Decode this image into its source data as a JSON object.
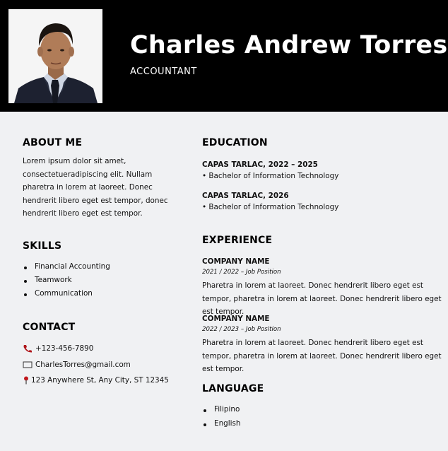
{
  "header": {
    "name": "Charles Andrew Torres",
    "role": "ACCOUNTANT"
  },
  "about": {
    "title": "ABOUT ME",
    "text": "Lorem ipsum dolor sit amet, consectetueradipiscing elit. Nullam pharetra in lorem at laoreet. Donec hendrerit libero eget est tempor, donec hendrerit libero eget est tempor."
  },
  "skills": {
    "title": "SKILLS",
    "items": [
      "Financial Accounting",
      "Teamwork",
      "Communication"
    ]
  },
  "contact": {
    "title": "CONTACT",
    "phone": "+123-456-7890",
    "email": "CharlesTorres@gmail.com",
    "address": "123 Anywhere St, Any City, ST 12345"
  },
  "education": {
    "title": "EDUCATION",
    "entries": [
      {
        "school": "CAPAS TARLAC, 2022 – 2025",
        "degree": "• Bachelor of Information Technology"
      },
      {
        "school": "CAPAS TARLAC, 2026",
        "degree": "• Bachelor of Information Technology"
      }
    ]
  },
  "experience": {
    "title": "EXPERIENCE",
    "jobs": [
      {
        "company": "COMPANY NAME",
        "meta": "2021 / 2022 – Job Position",
        "desc": "Pharetra in lorem at laoreet. Donec hendrerit libero eget est tempor, pharetra in lorem at laoreet. Donec hendrerit libero eget est tempor."
      },
      {
        "company": "COMPANY NAME",
        "meta": "2022 / 2023 – Job Position",
        "desc": "Pharetra in lorem at laoreet. Donec hendrerit libero eget est tempor, pharetra in lorem at laoreet. Donec hendrerit libero eget est tempor."
      }
    ]
  },
  "language": {
    "title": "LANGUAGE",
    "items": [
      "Filipino",
      "English"
    ]
  },
  "colors": {
    "header_bg": "#000000",
    "page_bg": "#f0f1f3",
    "phone_icon": "#b0161b"
  }
}
